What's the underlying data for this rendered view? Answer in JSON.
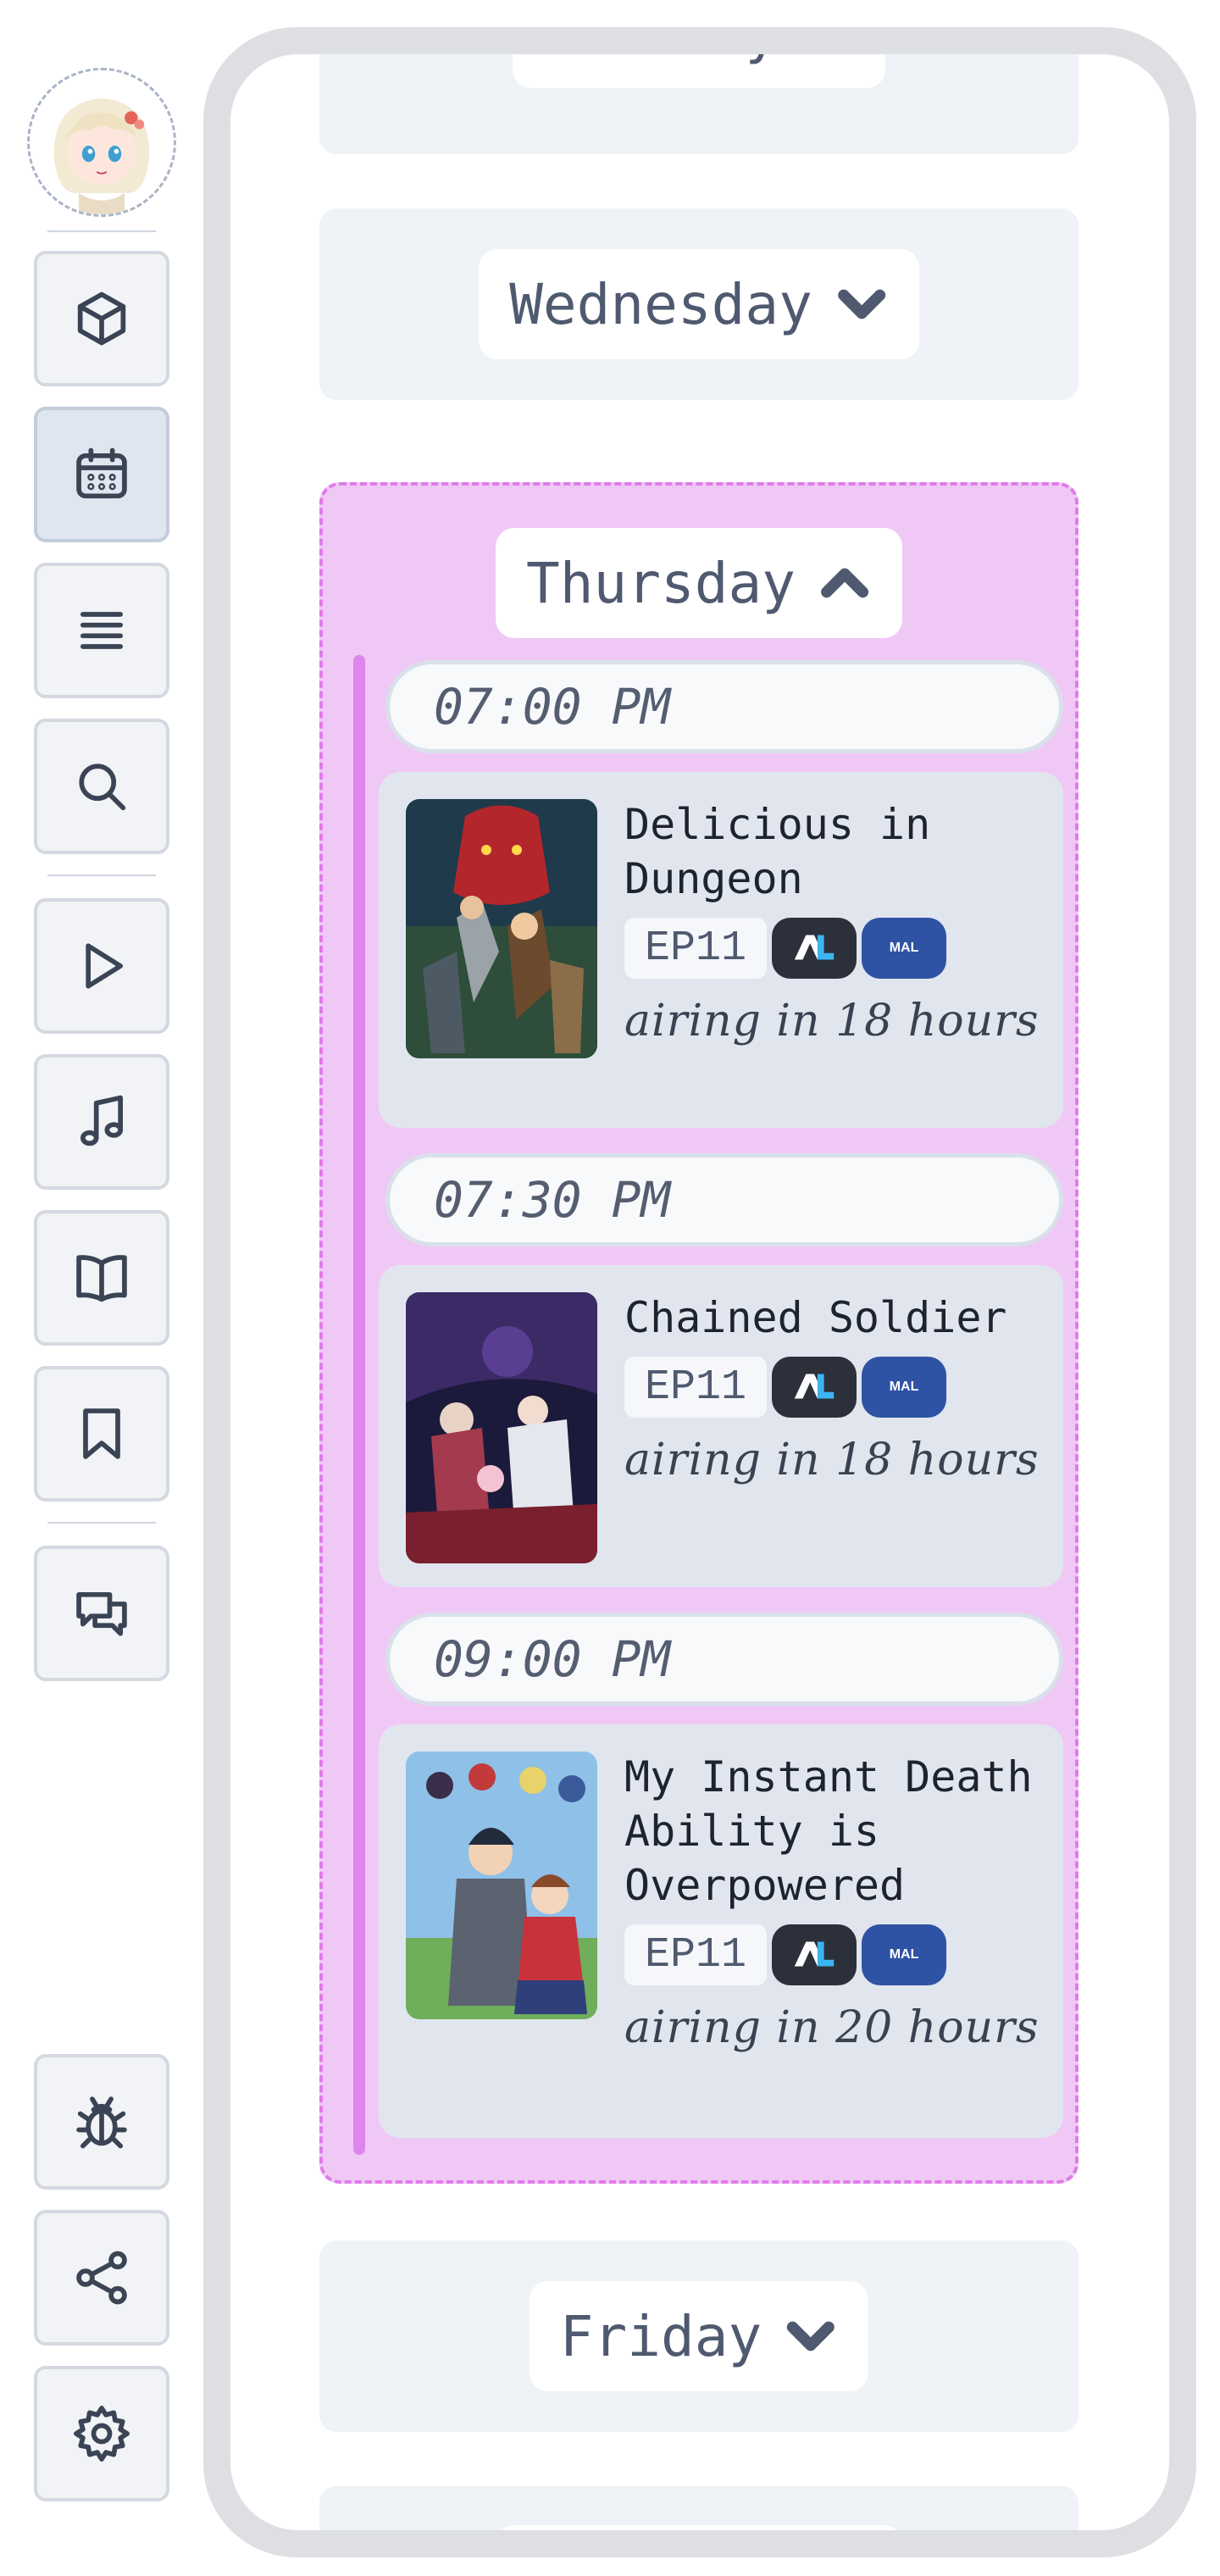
{
  "sidebar": {
    "avatar_alt": "user-avatar",
    "items": [
      {
        "name": "cube",
        "label": "cube-icon",
        "active": false
      },
      {
        "name": "calendar",
        "label": "calendar-icon",
        "active": true
      },
      {
        "name": "list",
        "label": "list-icon",
        "active": false
      },
      {
        "name": "search",
        "label": "search-icon",
        "active": false
      },
      {
        "name": "play",
        "label": "play-icon",
        "active": false
      },
      {
        "name": "music",
        "label": "music-icon",
        "active": false
      },
      {
        "name": "book",
        "label": "book-icon",
        "active": false
      },
      {
        "name": "bookmark",
        "label": "bookmark-icon",
        "active": false
      },
      {
        "name": "chat",
        "label": "chat-icon",
        "active": false
      },
      {
        "name": "bug",
        "label": "bug-icon",
        "active": false
      },
      {
        "name": "share",
        "label": "share-icon",
        "active": false
      },
      {
        "name": "settings",
        "label": "gear-icon",
        "active": false
      }
    ]
  },
  "schedule": {
    "days": {
      "tuesday": "Tuesday",
      "wednesday": "Wednesday",
      "thursday": "Thursday",
      "friday": "Friday"
    },
    "thursday_slots": [
      {
        "time": "07:00 PM",
        "title": "Delicious in Dungeon",
        "episode": "EP11",
        "airing": "airing in 18 hours"
      },
      {
        "time": "07:30 PM",
        "title": "Chained Soldier",
        "episode": "EP11",
        "airing": "airing in 18 hours"
      },
      {
        "time": "09:00 PM",
        "title": "My Instant Death Ability is Overpowered",
        "episode": "EP11",
        "airing": "airing in 20 hours"
      }
    ],
    "badges": {
      "anilist": "AL",
      "mal": "MAL"
    }
  },
  "colors": {
    "accent_pink": "#f0c8f6",
    "accent_border": "#e07bea",
    "anilist_bg": "#2b303b",
    "mal_bg": "#2e52a4"
  }
}
